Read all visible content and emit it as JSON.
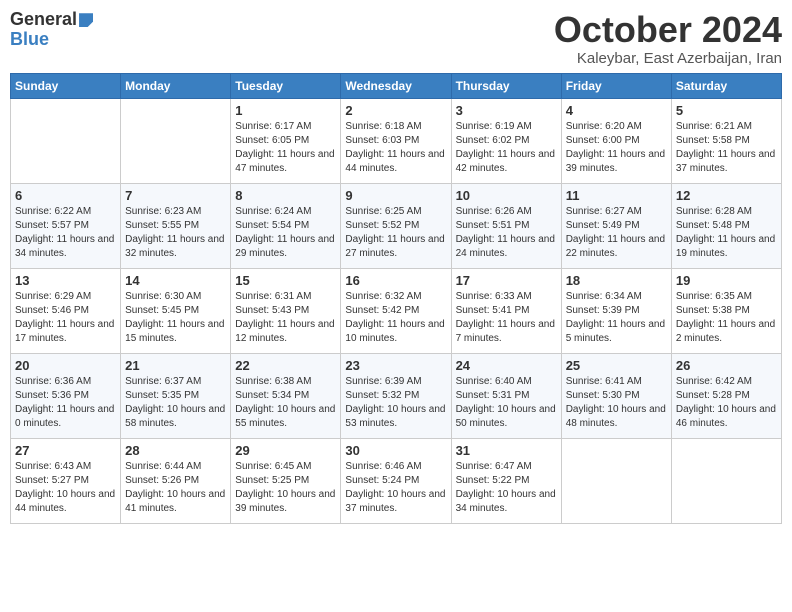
{
  "header": {
    "logo_general": "General",
    "logo_blue": "Blue",
    "month_title": "October 2024",
    "location": "Kaleybar, East Azerbaijan, Iran"
  },
  "days_of_week": [
    "Sunday",
    "Monday",
    "Tuesday",
    "Wednesday",
    "Thursday",
    "Friday",
    "Saturday"
  ],
  "weeks": [
    {
      "days": [
        {
          "num": "",
          "info": ""
        },
        {
          "num": "",
          "info": ""
        },
        {
          "num": "1",
          "info": "Sunrise: 6:17 AM\nSunset: 6:05 PM\nDaylight: 11 hours and 47 minutes."
        },
        {
          "num": "2",
          "info": "Sunrise: 6:18 AM\nSunset: 6:03 PM\nDaylight: 11 hours and 44 minutes."
        },
        {
          "num": "3",
          "info": "Sunrise: 6:19 AM\nSunset: 6:02 PM\nDaylight: 11 hours and 42 minutes."
        },
        {
          "num": "4",
          "info": "Sunrise: 6:20 AM\nSunset: 6:00 PM\nDaylight: 11 hours and 39 minutes."
        },
        {
          "num": "5",
          "info": "Sunrise: 6:21 AM\nSunset: 5:58 PM\nDaylight: 11 hours and 37 minutes."
        }
      ]
    },
    {
      "days": [
        {
          "num": "6",
          "info": "Sunrise: 6:22 AM\nSunset: 5:57 PM\nDaylight: 11 hours and 34 minutes."
        },
        {
          "num": "7",
          "info": "Sunrise: 6:23 AM\nSunset: 5:55 PM\nDaylight: 11 hours and 32 minutes."
        },
        {
          "num": "8",
          "info": "Sunrise: 6:24 AM\nSunset: 5:54 PM\nDaylight: 11 hours and 29 minutes."
        },
        {
          "num": "9",
          "info": "Sunrise: 6:25 AM\nSunset: 5:52 PM\nDaylight: 11 hours and 27 minutes."
        },
        {
          "num": "10",
          "info": "Sunrise: 6:26 AM\nSunset: 5:51 PM\nDaylight: 11 hours and 24 minutes."
        },
        {
          "num": "11",
          "info": "Sunrise: 6:27 AM\nSunset: 5:49 PM\nDaylight: 11 hours and 22 minutes."
        },
        {
          "num": "12",
          "info": "Sunrise: 6:28 AM\nSunset: 5:48 PM\nDaylight: 11 hours and 19 minutes."
        }
      ]
    },
    {
      "days": [
        {
          "num": "13",
          "info": "Sunrise: 6:29 AM\nSunset: 5:46 PM\nDaylight: 11 hours and 17 minutes."
        },
        {
          "num": "14",
          "info": "Sunrise: 6:30 AM\nSunset: 5:45 PM\nDaylight: 11 hours and 15 minutes."
        },
        {
          "num": "15",
          "info": "Sunrise: 6:31 AM\nSunset: 5:43 PM\nDaylight: 11 hours and 12 minutes."
        },
        {
          "num": "16",
          "info": "Sunrise: 6:32 AM\nSunset: 5:42 PM\nDaylight: 11 hours and 10 minutes."
        },
        {
          "num": "17",
          "info": "Sunrise: 6:33 AM\nSunset: 5:41 PM\nDaylight: 11 hours and 7 minutes."
        },
        {
          "num": "18",
          "info": "Sunrise: 6:34 AM\nSunset: 5:39 PM\nDaylight: 11 hours and 5 minutes."
        },
        {
          "num": "19",
          "info": "Sunrise: 6:35 AM\nSunset: 5:38 PM\nDaylight: 11 hours and 2 minutes."
        }
      ]
    },
    {
      "days": [
        {
          "num": "20",
          "info": "Sunrise: 6:36 AM\nSunset: 5:36 PM\nDaylight: 11 hours and 0 minutes."
        },
        {
          "num": "21",
          "info": "Sunrise: 6:37 AM\nSunset: 5:35 PM\nDaylight: 10 hours and 58 minutes."
        },
        {
          "num": "22",
          "info": "Sunrise: 6:38 AM\nSunset: 5:34 PM\nDaylight: 10 hours and 55 minutes."
        },
        {
          "num": "23",
          "info": "Sunrise: 6:39 AM\nSunset: 5:32 PM\nDaylight: 10 hours and 53 minutes."
        },
        {
          "num": "24",
          "info": "Sunrise: 6:40 AM\nSunset: 5:31 PM\nDaylight: 10 hours and 50 minutes."
        },
        {
          "num": "25",
          "info": "Sunrise: 6:41 AM\nSunset: 5:30 PM\nDaylight: 10 hours and 48 minutes."
        },
        {
          "num": "26",
          "info": "Sunrise: 6:42 AM\nSunset: 5:28 PM\nDaylight: 10 hours and 46 minutes."
        }
      ]
    },
    {
      "days": [
        {
          "num": "27",
          "info": "Sunrise: 6:43 AM\nSunset: 5:27 PM\nDaylight: 10 hours and 44 minutes."
        },
        {
          "num": "28",
          "info": "Sunrise: 6:44 AM\nSunset: 5:26 PM\nDaylight: 10 hours and 41 minutes."
        },
        {
          "num": "29",
          "info": "Sunrise: 6:45 AM\nSunset: 5:25 PM\nDaylight: 10 hours and 39 minutes."
        },
        {
          "num": "30",
          "info": "Sunrise: 6:46 AM\nSunset: 5:24 PM\nDaylight: 10 hours and 37 minutes."
        },
        {
          "num": "31",
          "info": "Sunrise: 6:47 AM\nSunset: 5:22 PM\nDaylight: 10 hours and 34 minutes."
        },
        {
          "num": "",
          "info": ""
        },
        {
          "num": "",
          "info": ""
        }
      ]
    }
  ]
}
